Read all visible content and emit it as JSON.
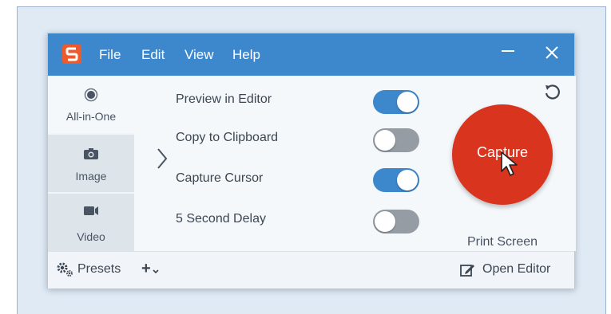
{
  "menu": {
    "file": "File",
    "edit": "Edit",
    "view": "View",
    "help": "Help"
  },
  "logo_letter": "S",
  "tabs": [
    {
      "label": "All-in-One",
      "icon": "radio-dot-icon",
      "active": true
    },
    {
      "label": "Image",
      "icon": "camera-icon",
      "active": false
    },
    {
      "label": "Video",
      "icon": "video-camera-icon",
      "active": false
    }
  ],
  "options": [
    {
      "label": "Preview in Editor",
      "on": true
    },
    {
      "label": "Copy to Clipboard",
      "on": false
    },
    {
      "label": "Capture Cursor",
      "on": true
    },
    {
      "label": "5 Second Delay",
      "on": false
    }
  ],
  "capture": {
    "label": "Capture",
    "hotkey": "Print Screen"
  },
  "footer": {
    "presets": "Presets",
    "add": "+",
    "open_editor": "Open Editor"
  },
  "colors": {
    "titlebar": "#3d87cc",
    "capture": "#d8341e",
    "toggle_on": "#3d87cc",
    "toggle_off": "#959ca3"
  }
}
